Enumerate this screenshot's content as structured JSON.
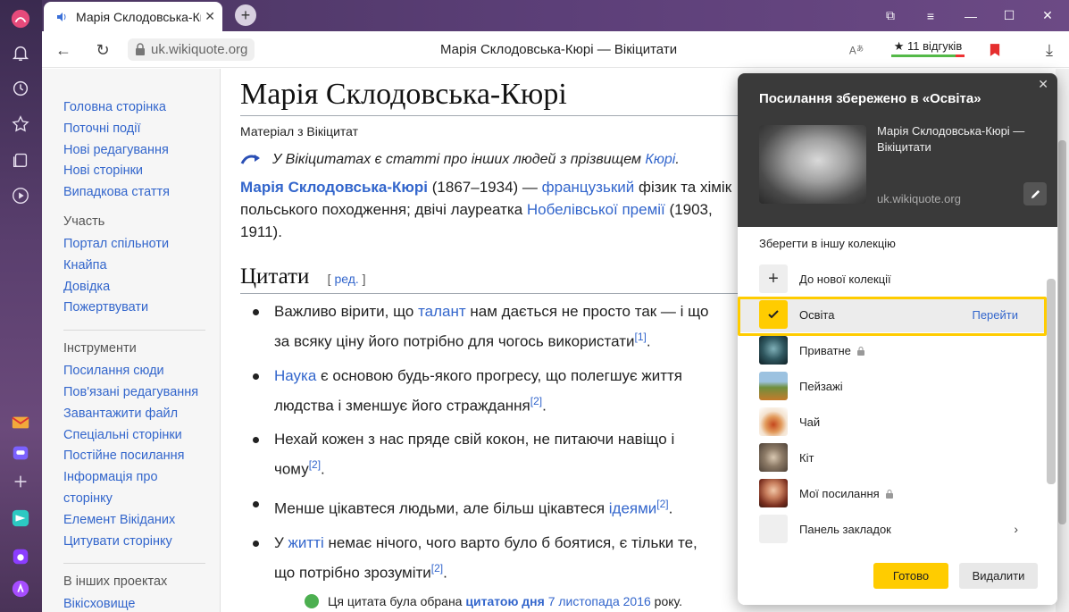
{
  "browser": {
    "tab_title": "Марія Склодовська-Кюрі",
    "tab_close": "✕",
    "new_tab": "+",
    "url": "uk.wikiquote.org",
    "page_title": "Марія Склодовська-Кюрі — Вікіцитати",
    "reviews": "★ 11 відгуків",
    "win": {
      "tabs": "⧉",
      "menu": "≡",
      "min": "—",
      "max": "☐",
      "close": "✕"
    },
    "nav": {
      "back": "←",
      "reload": "↻",
      "download": "⤓"
    }
  },
  "sidebar": {
    "main": [
      "Головна сторінка",
      "Поточні події",
      "Нові редагування",
      "Нові сторінки",
      "Випадкова стаття"
    ],
    "participation_head": "Участь",
    "participation": [
      "Портал спільноти",
      "Кнайпа",
      "Довідка",
      "Пожертвувати"
    ],
    "tools_head": "Інструменти",
    "tools": [
      "Посилання сюди",
      "Пов'язані редагування",
      "Завантажити файл",
      "Спеціальні сторінки",
      "Постійне посилання",
      "Інформація про сторінку",
      "Елемент Вікіданих",
      "Цитувати сторінку"
    ],
    "projects_head": "В інших проектах",
    "projects": [
      "Вікісховище"
    ]
  },
  "article": {
    "title": "Марія Склодовська-Кюрі",
    "subtitle": "Матеріал з Вікіцитат",
    "note_text": "У Вікіцитатах є статті про інших людей з прізвищем ",
    "note_link": "Кюрі",
    "lead_name": "Марія Склодовська-Кюрі",
    "lead_1": " (1867–1934) — ",
    "lead_link1": "французький",
    "lead_2": " фізик та хімік польського походження; двічі лауреатка ",
    "lead_link2": "Нобелівської премії",
    "lead_3": " (1903, 1911).",
    "section": "Цитати",
    "edit_open": "[ ",
    "edit_link": "ред.",
    "edit_close": " ]",
    "quotes": [
      {
        "a": "Важливо вірити, що ",
        "link": "талант",
        "b": " нам дається не просто так — і що за всяку ціну його потрібно для чогось використати",
        "ref": "[1]",
        "end": "."
      },
      {
        "a": "",
        "link": "Наука",
        "b": " є основою будь-якого прогресу, що полегшує життя людства і зменшує його страждання",
        "ref": "[2]",
        "end": "."
      },
      {
        "a": "Нехай кожен з нас пряде свій кокон, не питаючи навіщо і чому",
        "link": "",
        "b": "",
        "ref": "[2]",
        "end": "."
      },
      {
        "a": "Менше цікавтеся людьми, але більш цікавтеся ",
        "link": "ідеями",
        "b": "",
        "ref": "[2]",
        "end": "."
      },
      {
        "a": "У ",
        "link": "житті",
        "b": " немає нічого, чого варто було б боятися, є тільки те, що потрібно зрозуміти",
        "ref": "[2]",
        "end": "."
      }
    ],
    "qotd_1": "Ця цитата була обрана ",
    "qotd_link": "цитатою дня",
    "qotd_date": " 7 листопада 2016",
    "qotd_2": " року."
  },
  "popup": {
    "title": "Посилання збережено в «Освіта»",
    "close": "✕",
    "saved_title": "Марія Склодовська-Кюрі — Вікіцитати",
    "saved_domain": "uk.wikiquote.org",
    "collections_title": "Зберегти в іншу колекцію",
    "collections": [
      {
        "label": "До нової колекції",
        "icon": "plus-icon"
      },
      {
        "label": "Освіта",
        "icon": "check-icon",
        "action": "Перейти"
      },
      {
        "label": "Приватне",
        "icon": "cat-thumbnail",
        "locked": true
      },
      {
        "label": "Пейзажі",
        "icon": "landscape-thumbnail"
      },
      {
        "label": "Чай",
        "icon": "tea-thumbnail"
      },
      {
        "label": "Кіт",
        "icon": "cat-thumbnail"
      },
      {
        "label": "Мої посилання",
        "icon": "avatar-thumbnail",
        "locked": true
      },
      {
        "label": "Панель закладок",
        "icon": "folder-icon",
        "chevron": "›"
      }
    ],
    "ok": "Готово",
    "delete": "Видалити"
  },
  "colors": {
    "accent": "#ffcc00",
    "link": "#3366cc",
    "popup_header": "#3a3a3a"
  }
}
